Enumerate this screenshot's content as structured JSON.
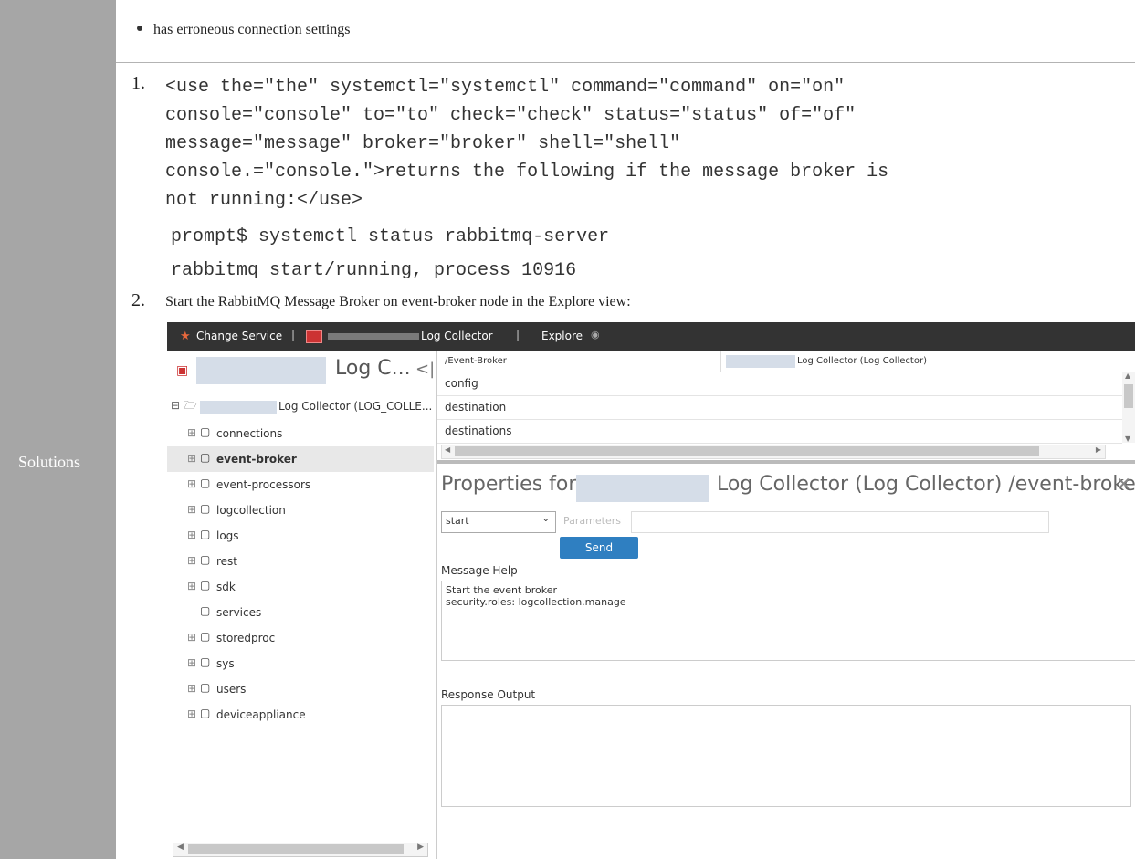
{
  "row_label": "Solutions",
  "bullet": "has erroneous connection settings",
  "step1": {
    "number": "1.",
    "lines": [
      "<use the=\"the\" systemctl=\"systemctl\" command=\"command\" on=\"on\"",
      "console=\"console\" to=\"to\" check=\"check\" status=\"status\" of=\"of\"",
      "message=\"message\" broker=\"broker\" shell=\"shell\"",
      "console.=\"console.\">returns the following if the message broker is",
      "not running:</use>"
    ],
    "code": [
      "prompt$ systemctl status rabbitmq-server",
      "rabbitmq start/running, process 10916"
    ]
  },
  "step2": {
    "number": "2.",
    "text": "Start the RabbitMQ Message Broker on event-broker node in the Explore view:"
  },
  "ui": {
    "topbar": {
      "change_service": "Change Service",
      "sep": "|",
      "log_collector": "Log Collector",
      "explore": "Explore"
    },
    "tree": {
      "header": "Log C...",
      "root": "Log Collector (LOG_COLLE...",
      "items": [
        "connections",
        "event-broker",
        "event-processors",
        "logcollection",
        "logs",
        "rest",
        "sdk",
        "services",
        "storedproc",
        "sys",
        "users",
        "deviceappliance"
      ],
      "selected": "event-broker"
    },
    "grid": {
      "col1": "/Event-Broker",
      "col2": "Log Collector (Log Collector)",
      "rows": [
        "config",
        "destination",
        "destinations"
      ]
    },
    "props": {
      "title_prefix": "Properties for",
      "title_suffix": "Log Collector (Log Collector) /event-broker.",
      "select_value": "start",
      "params_placeholder": "Parameters",
      "send": "Send",
      "help_label": "Message Help",
      "help_lines": [
        "Start the event broker",
        "security.roles: logcollection.manage"
      ],
      "response_label": "Response Output"
    }
  },
  "colors": {
    "left_col": "#a6a6a6",
    "accent": "#2f7fc1",
    "topbar": "#333333"
  }
}
